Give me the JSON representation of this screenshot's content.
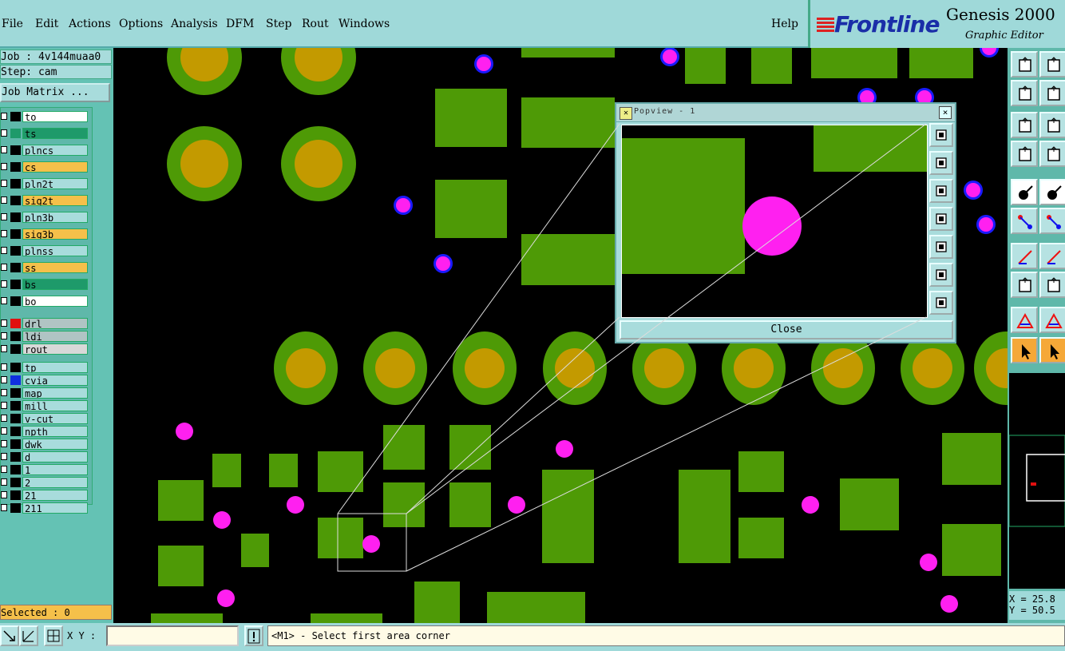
{
  "menu": {
    "items": [
      "File",
      "Edit",
      "Actions",
      "Options",
      "Analysis",
      "DFM",
      "Step",
      "Rout",
      "Windows"
    ],
    "help": "Help"
  },
  "brand": {
    "logo": "Frontline",
    "product": "Genesis 2000",
    "subtitle": "Graphic Editor"
  },
  "job": {
    "job_line": "Job : 4v144muaa0",
    "step_line": "Step: cam",
    "matrix_button": "Job Matrix ..."
  },
  "layers": [
    {
      "name": "to",
      "color": "#ffffff",
      "swatch": "#000000"
    },
    {
      "name": "ts",
      "color": "#1e9a6a",
      "swatch": "#1e9a6a"
    },
    {
      "name": "plncs",
      "color": "#a8dcdc",
      "swatch": "#000000"
    },
    {
      "name": "cs",
      "color": "#f5c04a",
      "swatch": "#000000"
    },
    {
      "name": "pln2t",
      "color": "#a8dcdc",
      "swatch": "#000000"
    },
    {
      "name": "sig2t",
      "color": "#f5c04a",
      "swatch": "#000000"
    },
    {
      "name": "pln3b",
      "color": "#a8dcdc",
      "swatch": "#000000"
    },
    {
      "name": "sig3b",
      "color": "#f5c04a",
      "swatch": "#000000"
    },
    {
      "name": "plnss",
      "color": "#a8dcdc",
      "swatch": "#000000"
    },
    {
      "name": "ss",
      "color": "#f5c04a",
      "swatch": "#000000"
    },
    {
      "name": "bs",
      "color": "#1e9a6a",
      "swatch": "#000000"
    },
    {
      "name": "bo",
      "color": "#ffffff",
      "swatch": "#000000"
    },
    {
      "name": "drl",
      "color": "#b0c4c4",
      "swatch": "#e01010"
    },
    {
      "name": "ldi",
      "color": "#b0c4c4",
      "swatch": "#000000"
    },
    {
      "name": "rout",
      "color": "#d8d8d8",
      "swatch": "#000000"
    },
    {
      "name": "tp",
      "color": "#a8dcdc",
      "swatch": "#000000"
    },
    {
      "name": "cvia",
      "color": "#a8dcdc",
      "swatch": "#1030e0"
    },
    {
      "name": "map",
      "color": "#a8dcdc",
      "swatch": "#000000"
    },
    {
      "name": "mill",
      "color": "#a8dcdc",
      "swatch": "#000000"
    },
    {
      "name": "v-cut",
      "color": "#a8dcdc",
      "swatch": "#000000"
    },
    {
      "name": "npth",
      "color": "#a8dcdc",
      "swatch": "#000000"
    },
    {
      "name": "dwk",
      "color": "#a8dcdc",
      "swatch": "#000000"
    },
    {
      "name": "d",
      "color": "#a8dcdc",
      "swatch": "#000000"
    },
    {
      "name": "1",
      "color": "#a8dcdc",
      "swatch": "#000000"
    },
    {
      "name": "2",
      "color": "#a8dcdc",
      "swatch": "#000000"
    },
    {
      "name": "21",
      "color": "#a8dcdc",
      "swatch": "#000000"
    },
    {
      "name": "211",
      "color": "#a8dcdc",
      "swatch": "#000000"
    }
  ],
  "selected_label": "Selected : 0",
  "popview": {
    "title": "Popview - 1",
    "close_label": "Close"
  },
  "coords": {
    "x_line": "X = 25.8",
    "y_line": "Y = 50.5"
  },
  "bottom": {
    "xy_label": "X Y :",
    "xy_value": "",
    "status": "<M1> - Select first area corner"
  },
  "colors": {
    "pad_green": "#4e9a06",
    "pad_gold": "#c39a00",
    "via_magenta": "#ff20f0",
    "via_ring": "#1a1aff",
    "ui_cyan": "#9fd9d9"
  }
}
